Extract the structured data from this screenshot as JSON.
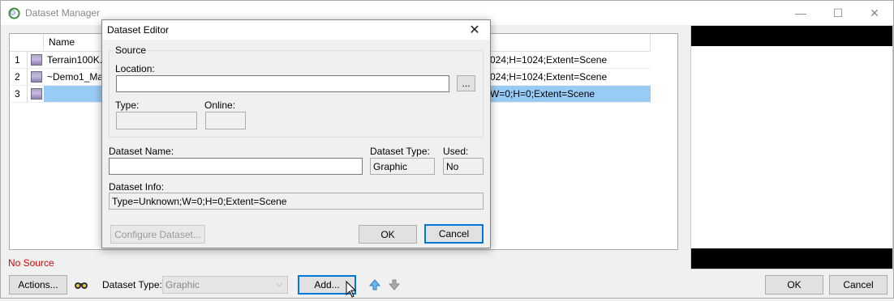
{
  "window": {
    "title": "Dataset Manager",
    "controls": {
      "minimize": "—",
      "maximize": "☐",
      "close": "✕"
    }
  },
  "list": {
    "columns": {
      "num": "",
      "name": "Name"
    },
    "rows": [
      {
        "num": "1",
        "name": "Terrain100K.b",
        "info": "024;H=1024;Extent=Scene",
        "selected": false
      },
      {
        "num": "2",
        "name": "~Demo1_Map",
        "info": "024;H=1024;Extent=Scene",
        "selected": false
      },
      {
        "num": "3",
        "name": "",
        "info": "W=0;H=0;Extent=Scene",
        "selected": true
      }
    ]
  },
  "status": {
    "no_source": "No Source"
  },
  "bottom": {
    "actions_label": "Actions...",
    "dataset_type_label": "Dataset Type:",
    "dataset_type_value": "Graphic",
    "add_label": "Add...",
    "ok_label": "OK",
    "cancel_label": "Cancel"
  },
  "dialog": {
    "title": "Dataset Editor",
    "source_legend": "Source",
    "location_label": "Location:",
    "location_value": "",
    "browse_label": "...",
    "type_label": "Type:",
    "type_value": "",
    "online_label": "Online:",
    "online_value": "",
    "dataset_name_label": "Dataset Name:",
    "dataset_name_value": "",
    "dataset_type_label": "Dataset Type:",
    "dataset_type_value": "Graphic",
    "used_label": "Used:",
    "used_value": "No",
    "dataset_info_label": "Dataset Info:",
    "dataset_info_value": "Type=Unknown;W=0;H=0;Extent=Scene",
    "configure_label": "Configure Dataset...",
    "ok_label": "OK",
    "cancel_label": "Cancel"
  },
  "colors": {
    "selection": "#99ccf5",
    "focus": "#0078d7",
    "error_text": "#e00000"
  }
}
